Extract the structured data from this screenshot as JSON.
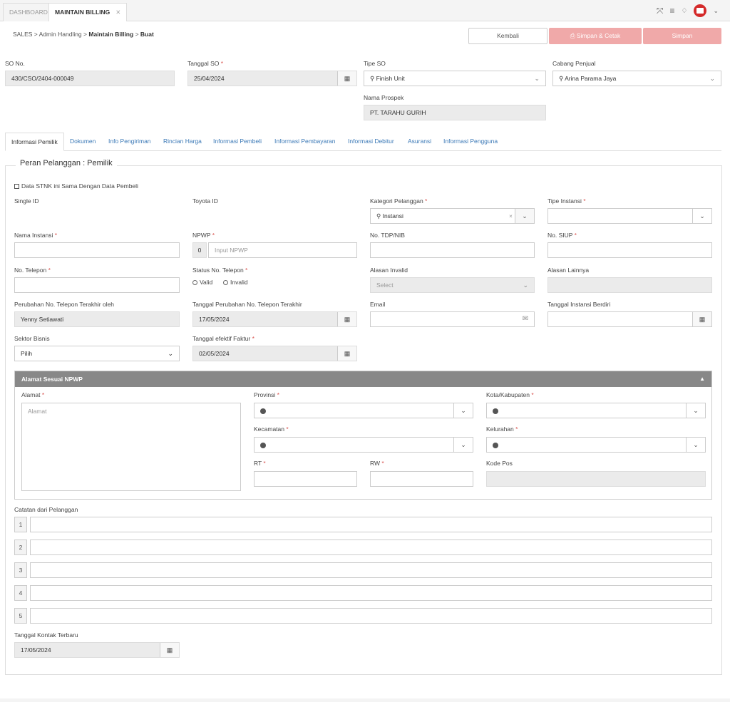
{
  "tabs": {
    "dashboard": "DASHBOARD",
    "maintain": "MAINTAIN BILLING",
    "close": "✕"
  },
  "top_icons": {
    "expand": "⤧",
    "menu": "≡",
    "bell": "🔔",
    "chevron": "⌄"
  },
  "breadcrumb": {
    "sales": "SALES",
    "sep": ">",
    "admin": "Admin Handling",
    "maintain": "Maintain Billing",
    "buat": "Buat"
  },
  "buttons": {
    "back": "Kembali",
    "print": "Simpan & Cetak",
    "save": "Simpan"
  },
  "header": {
    "so_no_label": "SO No.",
    "so_no_value": "430/CSO/2404-000049",
    "tanggal_so_label": "Tanggal SO",
    "tanggal_so_value": "25/04/2024",
    "tipe_so_label": "Tipe SO",
    "tipe_so_value": "Finish Unit",
    "cabang_label": "Cabang Penjual",
    "cabang_value": "Arina Parama Jaya",
    "prospek_label": "Nama Prospek",
    "prospek_value": "PT. TARAHU GURIH"
  },
  "form_tabs": [
    "Informasi Pemilik",
    "Dokumen",
    "Info Pengiriman",
    "Rincian Harga",
    "Informasi Pembeli",
    "Informasi Pembayaran",
    "Informasi Debitur",
    "Asuransi",
    "Informasi Pengguna"
  ],
  "section": {
    "title": "Peran Pelanggan : Pemilik",
    "same_as_buyer": "Data STNK ini Sama Dengan Data Pembeli"
  },
  "fields": {
    "single_id": "Single ID",
    "toyota_id": "Toyota ID",
    "kategori_label": "Kategori Pelanggan",
    "kategori_value": "Instansi",
    "tipe_instansi_label": "Tipe Instansi",
    "nama_instansi_label": "Nama Instansi",
    "npwp_label": "NPWP",
    "npwp_prefix": "0",
    "npwp_placeholder": "Input NPWP",
    "tdp_label": "No. TDP/NIB",
    "siup_label": "No. SIUP",
    "telepon_label": "No. Telepon",
    "status_telepon_label": "Status No. Telepon",
    "valid": "Valid",
    "invalid": "Invalid",
    "alasan_invalid_label": "Alasan Invalid",
    "alasan_invalid_placeholder": "Select",
    "alasan_lainnya_label": "Alasan Lainnya",
    "perubahan_oleh_label": "Perubahan No. Telepon Terakhir oleh",
    "perubahan_oleh_value": "Yenny Setiawati",
    "tanggal_perubahan_label": "Tanggal Perubahan No. Telepon Terakhir",
    "tanggal_perubahan_value": "17/05/2024",
    "email_label": "Email",
    "tanggal_instansi_label": "Tanggal Instansi Berdiri",
    "sektor_label": "Sektor Bisnis",
    "sektor_value": "Pilih",
    "tanggal_faktur_label": "Tanggal efektif Faktur",
    "tanggal_faktur_value": "02/05/2024"
  },
  "address": {
    "title": "Alamat Sesuai NPWP",
    "alamat_label": "Alamat",
    "alamat_placeholder": "Alamat",
    "provinsi_label": "Provinsi",
    "kota_label": "Kota/Kabupaten",
    "kecamatan_label": "Kecamatan",
    "kelurahan_label": "Kelurahan",
    "rt_label": "RT",
    "rw_label": "RW",
    "kode_pos_label": "Kode Pos"
  },
  "notes": {
    "label": "Catatan dari Pelanggan",
    "rows": [
      "1",
      "2",
      "3",
      "4",
      "5"
    ]
  },
  "last_contact": {
    "label": "Tanggal Kontak Terbaru",
    "value": "17/05/2024"
  },
  "required_mark": "*",
  "colors": {
    "primary_link": "#3a78b6",
    "disabled_button": "#f0a9a9",
    "header_bar": "#888888",
    "required": "#d9534f"
  }
}
